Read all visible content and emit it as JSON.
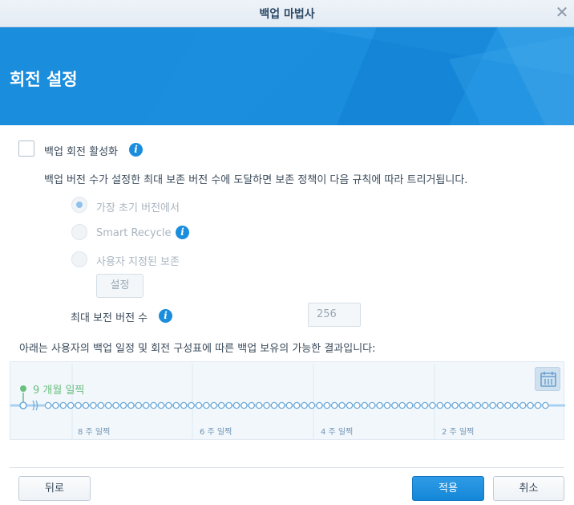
{
  "window": {
    "title": "백업 마법사",
    "close_icon": "close-icon"
  },
  "header": {
    "heading": "회전 설정",
    "banner_color": "#1a8ddd"
  },
  "rotation": {
    "enable_label": "백업 회전 활성화",
    "enabled": false,
    "description": "백업 버전 수가 설정한 최대 보존 버전 수에 도달하면 보존 정책이 다음 규칙에 따라 트리거됩니다.",
    "options": [
      {
        "label": "가장 초기 버전에서",
        "selected": true
      },
      {
        "label": "Smart Recycle",
        "selected": false,
        "info": true
      },
      {
        "label": "사용자 지정된 보존",
        "selected": false
      }
    ],
    "settings_button": "설정",
    "max_versions_label": "최대 보전 버전 수",
    "max_versions_value": "256"
  },
  "result": {
    "description": "아래는 사용자의 백업 일정 및 회전 구성표에 따른 백업 보유의 가능한 결과입니다:",
    "start_label": "9 개월 일찍",
    "week_labels": [
      "8 주 일찍",
      "6 주 일찍",
      "4 주 일찍",
      "2 주 일찍"
    ],
    "calendar_icon": "calendar-icon"
  },
  "footer": {
    "back_label": "뒤로",
    "apply_label": "적용",
    "cancel_label": "취소"
  },
  "colors": {
    "accent": "#1a8ddd",
    "timeline_dot": "#ffffff",
    "start_marker": "#6bbf7e"
  }
}
